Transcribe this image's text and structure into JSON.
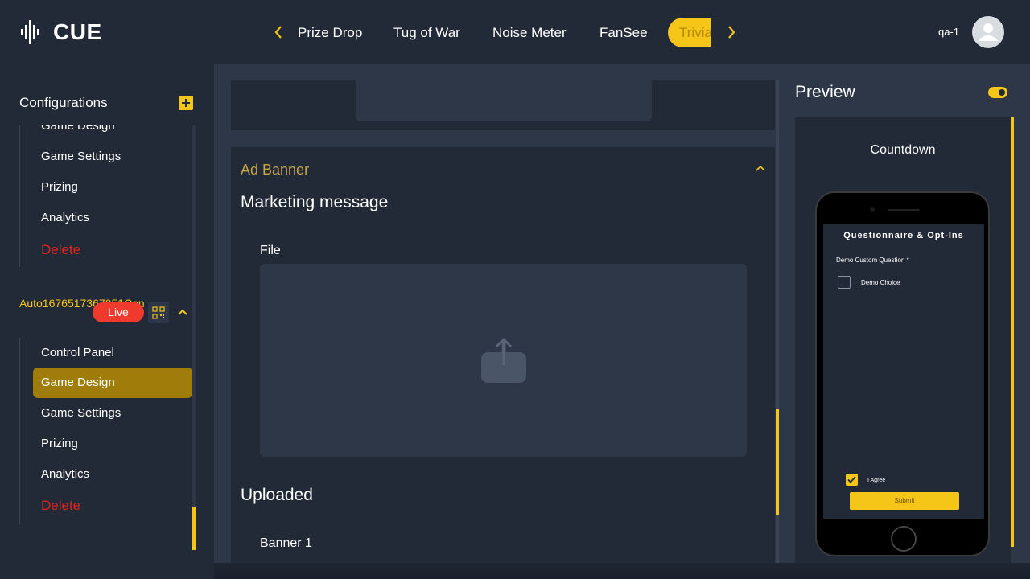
{
  "header": {
    "logo_text": "CUE",
    "tabs": [
      "Prize Drop",
      "Tug of War",
      "Noise Meter",
      "FanSee",
      "Trivia"
    ],
    "active_tab": "Trivia",
    "user_name": "qa-1"
  },
  "sidebar": {
    "title": "Configurations",
    "group1_items": [
      "Game Design",
      "Game Settings",
      "Prizing",
      "Analytics",
      "Delete"
    ],
    "event": {
      "name": "Auto1676517367051Con",
      "status": "Live"
    },
    "group2_items": [
      "Control Panel",
      "Game Design",
      "Game Settings",
      "Prizing",
      "Analytics",
      "Delete"
    ],
    "selected_item": "Game Design"
  },
  "main": {
    "section_title": "Ad Banner",
    "marketing_message_label": "Marketing message",
    "file_label": "File",
    "uploaded_label": "Uploaded",
    "banner_label": "Banner 1"
  },
  "preview": {
    "title": "Preview",
    "screen_title": "Countdown",
    "phone": {
      "heading": "Questionnaire & Opt-Ins",
      "question": "Demo Custom Question *",
      "choice": "Demo Choice",
      "agree_label": "I Agree",
      "submit_label": "Submit"
    }
  },
  "colors": {
    "accent": "#f5c518",
    "live": "#f03a2e",
    "delete": "#e0241c",
    "panel": "#222a37",
    "background": "#2d3748"
  }
}
